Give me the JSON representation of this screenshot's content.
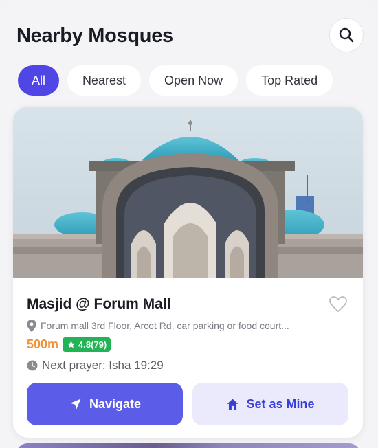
{
  "header": {
    "title": "Nearby Mosques",
    "search_icon": "search-icon"
  },
  "filters": [
    {
      "label": "All",
      "active": true
    },
    {
      "label": "Nearest",
      "active": false
    },
    {
      "label": "Open Now",
      "active": false
    },
    {
      "label": "Top Rated",
      "active": false
    }
  ],
  "card": {
    "name": "Masjid @ Forum Mall",
    "address": "Forum mall 3rd Floor, Arcot Rd, car parking or food court...",
    "distance": "500m",
    "rating": "4.8(79)",
    "next_prayer": "Next prayer: Isha 19:29",
    "navigate_label": "Navigate",
    "set_mine_label": "Set as Mine"
  },
  "colors": {
    "accent": "#4f46e5",
    "navigate_bg": "#5b5ce8",
    "set_mine_bg": "#ebeafd",
    "distance": "#f0923a",
    "rating_bg": "#22b357"
  }
}
